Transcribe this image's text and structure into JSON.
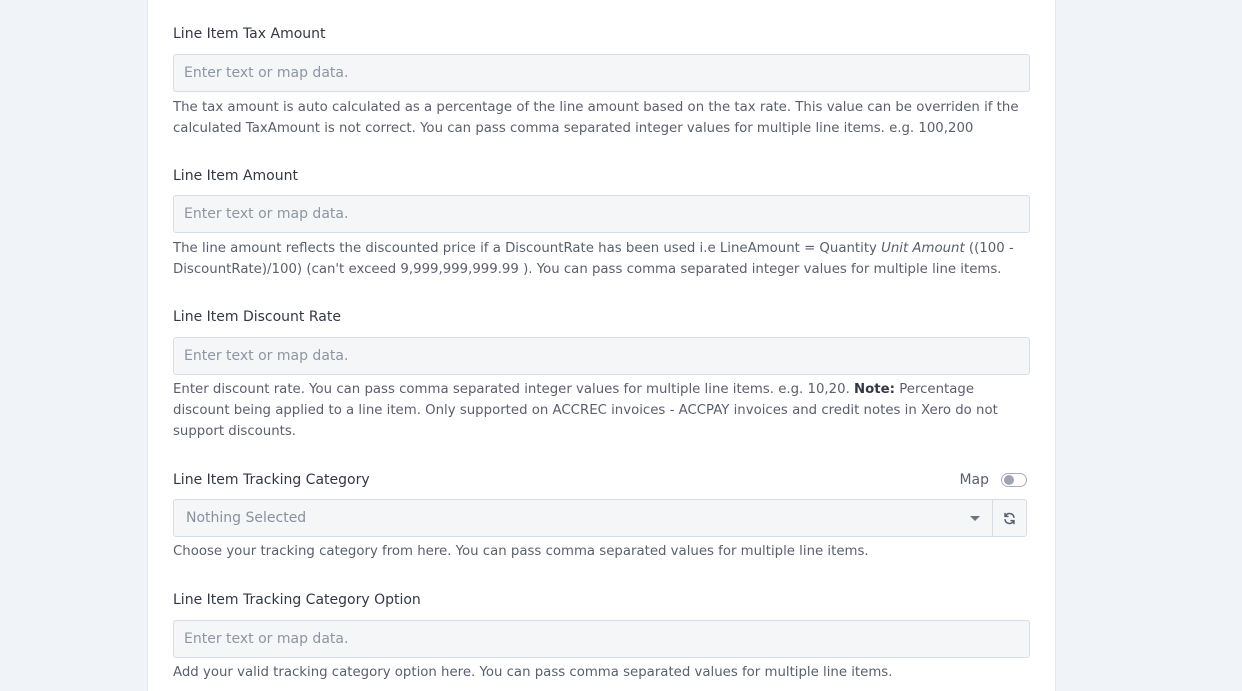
{
  "fields": [
    {
      "label": "Line Item Tax Amount",
      "placeholder": "Enter text or map data.",
      "help": "The tax amount is auto calculated as a percentage of the line amount based on the tax rate. This value can be overriden if the calculated TaxAmount is not correct. You can pass comma separated integer values for multiple line items. e.g. 100,200"
    },
    {
      "label": "Line Item Amount",
      "placeholder": "Enter text or map data.",
      "help_pre": "The line amount reflects the discounted price if a DiscountRate has been used i.e LineAmount = Quantity ",
      "help_italic": "Unit Amount",
      "help_post": " ((100 - DiscountRate)/100) (can't exceed 9,999,999,999.99 ). You can pass comma separated integer values for multiple line items."
    },
    {
      "label": "Line Item Discount Rate",
      "placeholder": "Enter text or map data.",
      "help_pre": "Enter discount rate. You can pass comma separated integer values for multiple line items. e.g. 10,20. ",
      "help_bold": "Note:",
      "help_post": " Percentage discount being applied to a line item. Only supported on ACCREC invoices - ACCPAY invoices and credit notes in Xero do not support discounts."
    },
    {
      "label": "Line Item Tracking Category",
      "map_label": "Map",
      "map_enabled": false,
      "selected": "Nothing Selected",
      "help": "Choose your tracking category from here. You can pass comma separated values for multiple line items."
    },
    {
      "label": "Line Item Tracking Category Option",
      "placeholder": "Enter text or map data.",
      "help": "Add your valid tracking category option here. You can pass comma separated values for multiple line items."
    }
  ]
}
